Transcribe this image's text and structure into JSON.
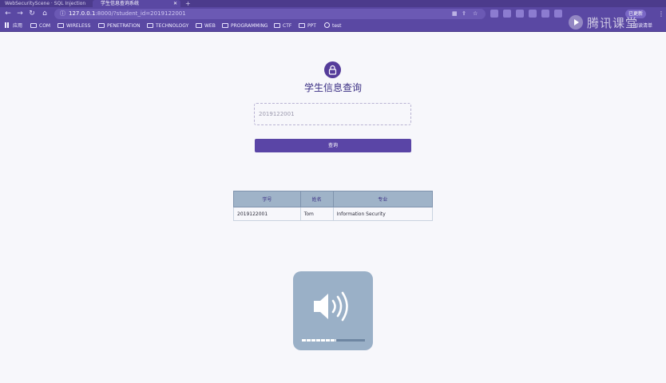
{
  "browser": {
    "tabs": [
      {
        "title": "WebSecurityScene · SQL Injection"
      },
      {
        "title": "学生信息查询系统"
      }
    ],
    "url_host": "127.0.0.1",
    "url_port": ":8000",
    "url_path": "/?student_id=2019122001",
    "update_label": "已更新",
    "bookmarks": [
      {
        "label": "应用",
        "icon": "apps-grid-icon"
      },
      {
        "label": "COM",
        "icon": "folder-icon"
      },
      {
        "label": "WIRELESS",
        "icon": "folder-icon"
      },
      {
        "label": "PENETRATION",
        "icon": "folder-icon"
      },
      {
        "label": "TECHNOLOGY",
        "icon": "folder-icon"
      },
      {
        "label": "WEB",
        "icon": "folder-icon"
      },
      {
        "label": "PROGRAMMING",
        "icon": "folder-icon"
      },
      {
        "label": "CTF",
        "icon": "folder-icon"
      },
      {
        "label": "PPT",
        "icon": "folder-icon"
      },
      {
        "label": "test",
        "icon": "globe-icon"
      }
    ],
    "reading_list": "阅读清单"
  },
  "page": {
    "title": "学生信息查询",
    "search_value": "2019122001",
    "query_button": "查询",
    "table": {
      "headers": [
        "学号",
        "姓名",
        "专业"
      ],
      "rows": [
        [
          "2019122001",
          "Tom",
          "Information Security"
        ]
      ]
    }
  },
  "volume_overlay": {
    "icon": "speaker-icon",
    "level": 0.55
  },
  "watermark": {
    "text": "腾讯课堂"
  }
}
